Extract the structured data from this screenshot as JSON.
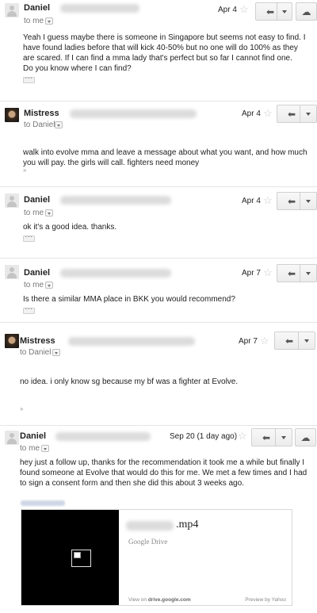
{
  "messages": [
    {
      "sender": "Daniel",
      "to": "to me",
      "date": "Apr 4",
      "body": "Yeah I guess maybe there is someone in Singapore but seems not easy to find. I have found ladies before that will kick 40-50% but no one will do 100% as they are scared. If I can find a mma lady that's perfect but so far I cannot find one.",
      "body2": "Do you know where I can find?"
    },
    {
      "sender": "Mistress",
      "to": "to Daniel",
      "date": "Apr 4",
      "body": "walk into evolve mma and leave a message about what you want, and how much you will pay.  the girls will call.  fighters need money"
    },
    {
      "sender": "Daniel",
      "to": "to me",
      "date": "Apr 4",
      "body": "ok it's a good idea. thanks."
    },
    {
      "sender": "Daniel",
      "to": "to me",
      "date": "Apr 7",
      "body": "Is there a similar MMA place in BKK you would recommend?"
    },
    {
      "sender": "Mistress",
      "to": "to Daniel",
      "date": "Apr 7",
      "body": "no idea.  i only know sg because my bf was a fighter at Evolve."
    },
    {
      "sender": "Daniel",
      "to": "to me",
      "date": "Sep 20 (1 day ago)",
      "body": "hey just a follow up, thanks for the recommendation it took me a while but finally I found someone at Evolve that would do this for me.  We met a few times and I had to sign a consent form and then she did this about 3 weeks ago."
    }
  ],
  "attachment": {
    "file_ext": ".mp4",
    "service": "Google Drive",
    "view_on_prefix": "View on ",
    "view_on_domain": "drive.google.com",
    "preview_by": "Preview by Yahoo"
  },
  "icons": {
    "star": "☆",
    "reply": "⬅",
    "upload": "☁"
  }
}
